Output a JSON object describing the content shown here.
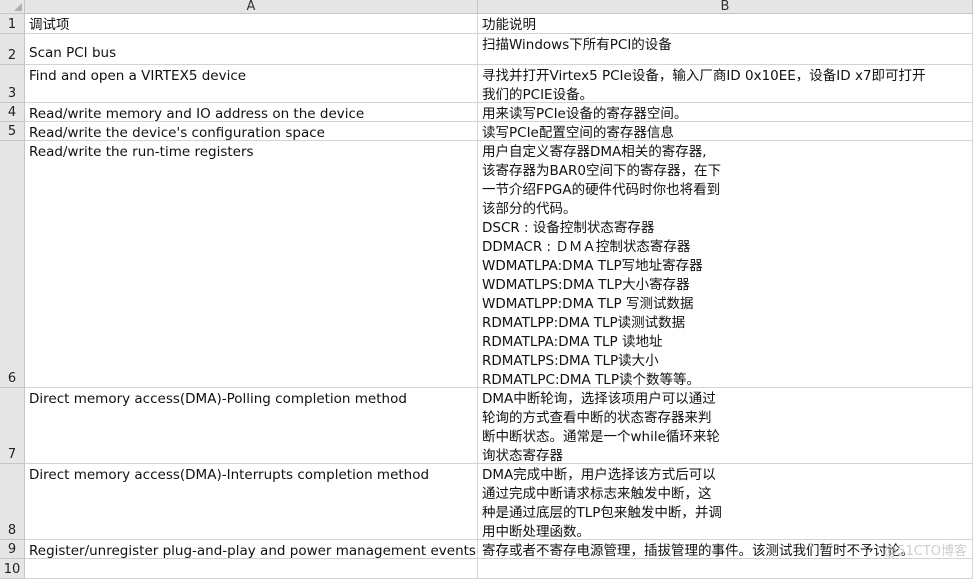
{
  "columns": [
    "A",
    "B"
  ],
  "rows": [
    {
      "num": "1",
      "a": "调试项",
      "b": [
        "功能说明"
      ]
    },
    {
      "num": "2",
      "a": "Scan PCI bus",
      "b": [
        "扫描Windows下所有PCI的设备"
      ]
    },
    {
      "num": "3",
      "a": "Find and open a VIRTEX5 device",
      "b": [
        "寻找并打开Virtex5 PCIe设备，输入厂商ID 0x10EE，设备ID x7即可打开",
        "我们的PCIE设备。"
      ]
    },
    {
      "num": "4",
      "a": "Read/write memory and IO address on the device",
      "b": [
        "用来读写PCIe设备的寄存器空间。"
      ]
    },
    {
      "num": "5",
      "a": "Read/write the device's configuration space",
      "b": [
        "读写PCIe配置空间的寄存器信息"
      ]
    },
    {
      "num": "6",
      "a": "Read/write the run-time registers",
      "b": [
        "用户自定义寄存器DMA相关的寄存器,",
        "该寄存器为BAR0空间下的寄存器，在下",
        "一节介绍FPGA的硬件代码时你也将看到",
        "该部分的代码。",
        "DSCR : 设备控制状态寄存器",
        "DDMACR : ＤＭＡ控制状态寄存器",
        "WDMATLPA:DMA TLP写地址寄存器",
        "WDMATLPS:DMA TLP大小寄存器",
        "WDMATLPP:DMA TLP 写测试数据",
        "RDMATLPP:DMA TLP读测试数据",
        "RDMATLPA:DMA TLP 读地址",
        "RDMATLPS:DMA TLP读大小",
        "RDMATLPC:DMA TLP读个数等等。"
      ]
    },
    {
      "num": "7",
      "a": "Direct memory access(DMA)-Polling completion method",
      "b": [
        "DMA中断轮询，选择该项用户可以通过",
        "轮询的方式查看中断的状态寄存器来判",
        "断中断状态。通常是一个while循环来轮",
        "询状态寄存器"
      ]
    },
    {
      "num": "8",
      "a": "Direct memory access(DMA)-Interrupts completion method",
      "b": [
        "DMA完成中断，用户选择该方式后可以",
        "通过完成中断请求标志来触发中断，这",
        "种是通过底层的TLP包来触发中断，并调",
        "用中断处理函数。"
      ]
    },
    {
      "num": "9",
      "a": "Register/unregister plug-and-play and power management events",
      "b": [
        "寄存或者不寄存电源管理，插拔管理的事件。该测试我们暂时不予讨论。"
      ]
    },
    {
      "num": "10",
      "a": "",
      "b": []
    }
  ],
  "watermark": "@51CTO博客"
}
